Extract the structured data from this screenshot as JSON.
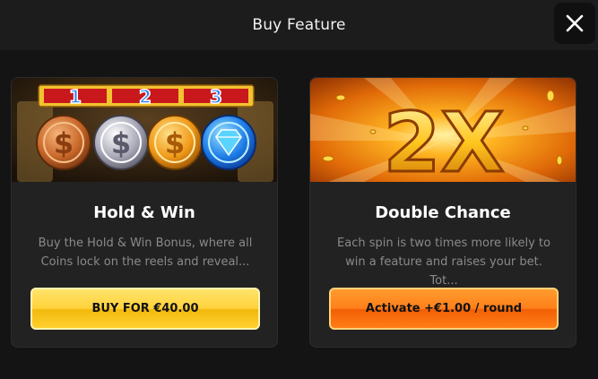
{
  "header": {
    "title": "Buy Feature",
    "close_icon": "close-icon"
  },
  "cards": [
    {
      "banner_numbers": [
        "1",
        "2",
        "3"
      ],
      "title": "Hold & Win",
      "description": "Buy the Hold & Win Bonus, where all Coins lock on the reels and reveal...",
      "button_label": "BUY FOR €40.00",
      "image_icons": [
        "bronze-coin-icon",
        "silver-coin-icon",
        "gold-coin-icon",
        "diamond-coin-icon"
      ]
    },
    {
      "multiplier": "2X",
      "title": "Double Chance",
      "description": "Each spin is two times more likely to win a feature and raises your bet. Tot...",
      "button_label": "Activate +€1.00 / round"
    }
  ],
  "colors": {
    "accent_yellow": "#ffd23a",
    "accent_orange": "#ff7f1a",
    "background": "#141414",
    "card": "#222222"
  }
}
